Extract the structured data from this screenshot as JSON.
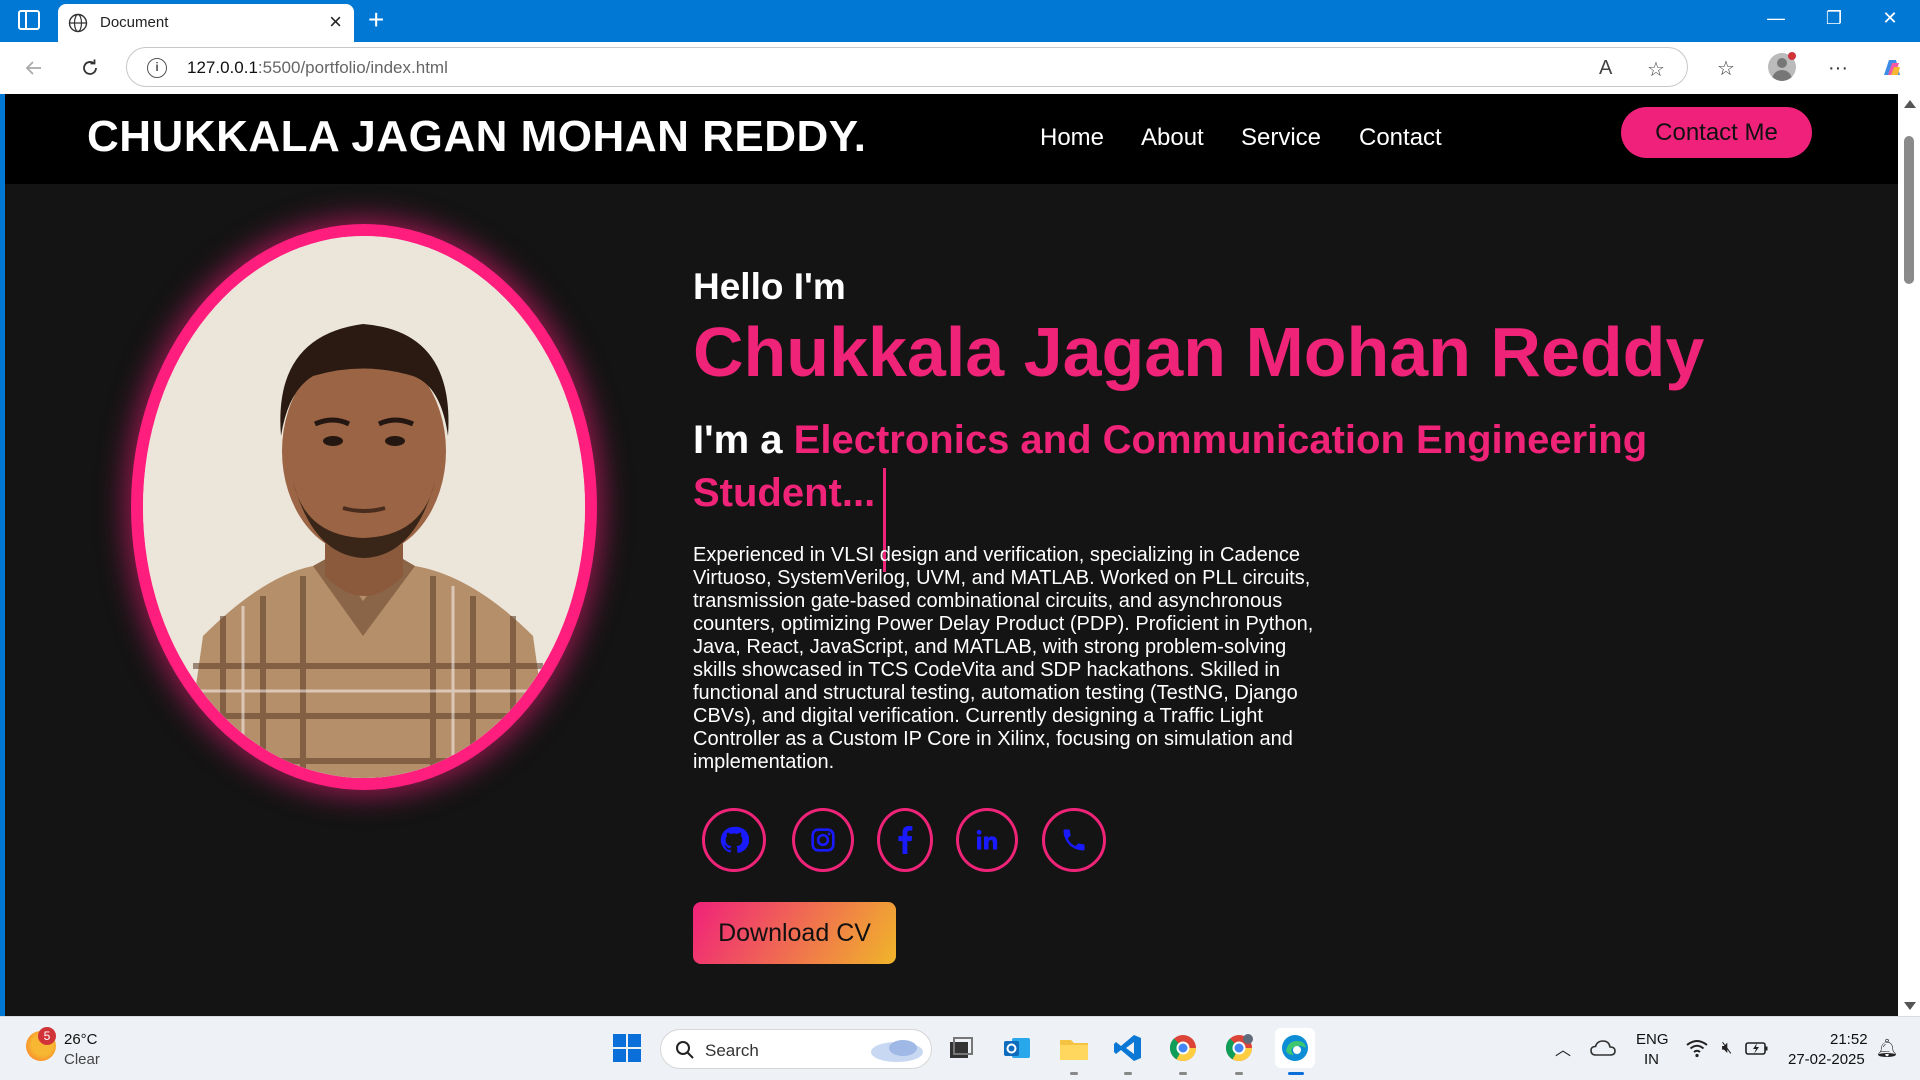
{
  "browser": {
    "tab_title": "Document",
    "url_host": "127.0.0.1",
    "url_path": ":5500/portfolio/index.html"
  },
  "site": {
    "logo": "CHUKKALA JAGAN MOHAN REDDY.",
    "nav": [
      "Home",
      "About",
      "Service",
      "Contact"
    ],
    "contact_button": "Contact Me",
    "greeting": "Hello I'm",
    "name": "Chukkala Jagan Mohan Reddy",
    "role_prefix": "I'm a ",
    "role_typed": "Electronics and Communication Engineering Student...",
    "bio": "Experienced in VLSI design and verification, specializing in Cadence Virtuoso, SystemVerilog, UVM, and MATLAB. Worked on PLL circuits, transmission gate-based combinational circuits, and asynchronous counters, optimizing Power Delay Product (PDP). Proficient in Python, Java, React, JavaScript, and MATLAB, with strong problem-solving skills showcased in TCS CodeVita and SDP hackathons. Skilled in functional and structural testing, automation testing (TestNG, Django CBVs), and digital verification. Currently designing a Traffic Light Controller as a Custom IP Core in Xilinx, focusing on simulation and implementation.",
    "social_icons": [
      "github-icon",
      "instagram-icon",
      "facebook-icon",
      "linkedin-icon",
      "phone-icon"
    ],
    "download_button": "Download CV",
    "colors": {
      "accent": "#ef2378",
      "header_bg": "#000000",
      "page_bg": "#141414",
      "social_icon": "#1a1aff"
    }
  },
  "taskbar": {
    "weather_badge": "5",
    "weather_temp": "26°C",
    "weather_desc": "Clear",
    "search_label": "Search",
    "lang_line1": "ENG",
    "lang_line2": "IN",
    "time": "21:52",
    "date": "27-02-2025"
  }
}
